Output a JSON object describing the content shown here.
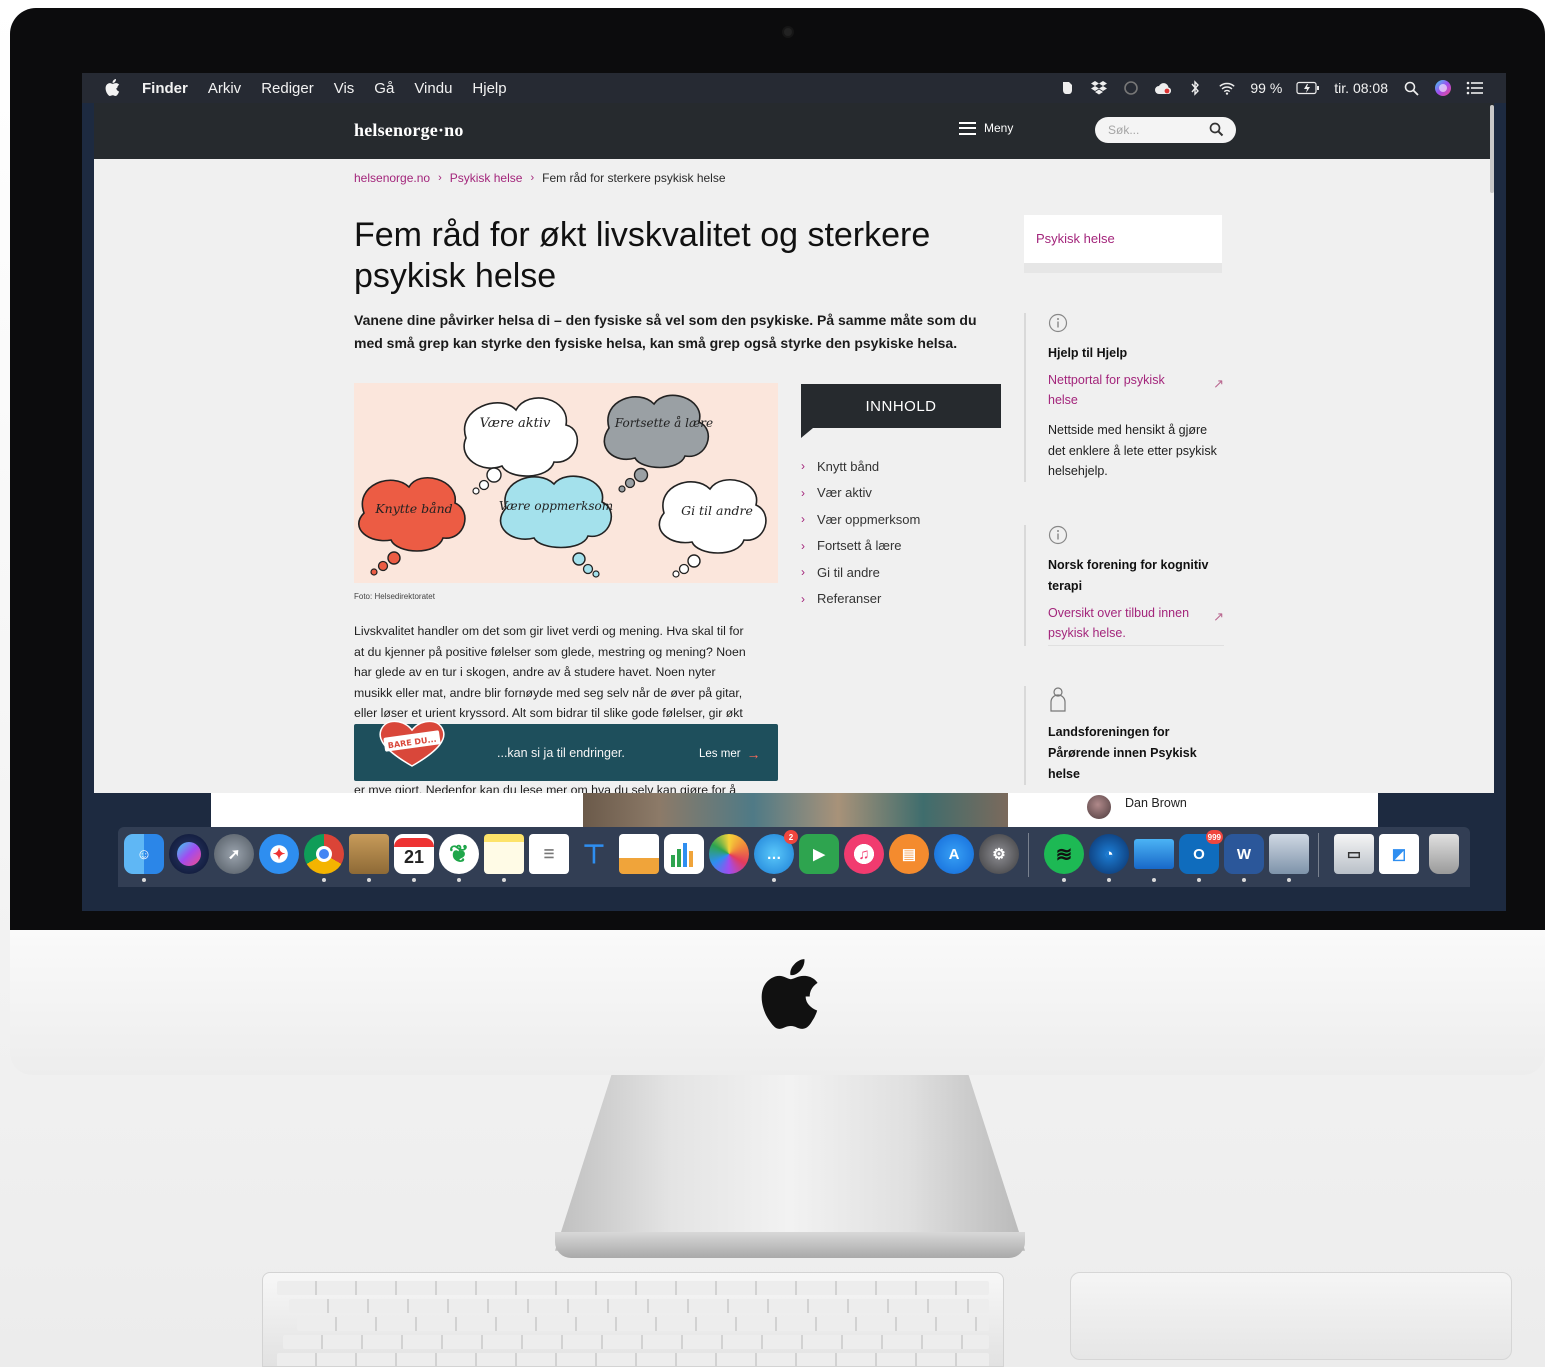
{
  "menubar": {
    "app_name": "Finder",
    "items": [
      "Arkiv",
      "Rediger",
      "Vis",
      "Gå",
      "Vindu",
      "Hjelp"
    ],
    "battery": "99 %",
    "clock": "tir. 08:08"
  },
  "site": {
    "logo": "helsenorge·no",
    "menu_label": "Meny",
    "search_placeholder": "Søk..."
  },
  "breadcrumb": [
    "helsenorge.no",
    "Psykisk helse",
    "Fem råd for sterkere psykisk helse"
  ],
  "article": {
    "title": "Fem råd for økt livskvalitet og sterkere psykisk helse",
    "ingress": "Vanene dine påvirker helsa di – den fysiske så vel som den psykiske. På samme måte som du med små grep kan styrke den fysiske helsa, kan små grep også styrke den psykiske helsa.",
    "photo_credit": "Foto: Helsedirektoratet",
    "clouds": [
      "Være aktiv",
      "Fortsette å lære",
      "Knytte bånd",
      "Være oppmerksom",
      "Gi til andre"
    ],
    "body_lines": [
      "Livskvalitet handler om det som gir livet verdi og mening. Hva skal til for",
      "at du kjenner på positive følelser som glede, mestring og mening? Noen",
      "har glede av en tur i skogen, andre av å studere havet. Noen nyter",
      "musikk eller mat, andre blir fornøyde med seg selv når de øver på gitar,",
      "eller løser et urient kryssord. Alt som bidrar til slike gode følelser, gir økt"
    ],
    "after_banner": "er mye gjort. Nedenfor kan du lese mer om hva du selv kan gjøre for å"
  },
  "toc": {
    "header": "INNHOLD",
    "items": [
      "Knytt bånd",
      "Vær aktiv",
      "Vær oppmerksom",
      "Fortsett å lære",
      "Gi til andre",
      "Referanser"
    ]
  },
  "banner": {
    "heart_text": "BARE DU...",
    "text": "...kan si ja til endringer.",
    "link": "Les mer"
  },
  "sidebar": {
    "tab": "Psykisk helse",
    "cards": [
      {
        "title": "Hjelp til Hjelp",
        "link": "Nettportal for psykisk helse",
        "desc": "Nettside med hensikt å gjøre det enklere å lete etter psykisk helsehjelp."
      },
      {
        "title": "Norsk forening for kognitiv terapi",
        "link": "Oversikt over tilbud innen psykisk helse."
      },
      {
        "title": "Landsforeningen for Pårørende innen Psykisk helse"
      }
    ]
  },
  "underlying": {
    "user_name": "Dan Brown"
  },
  "dock": {
    "calendar_day": "21",
    "badges": {
      "messages": "2",
      "outlook": "999"
    }
  },
  "colors": {
    "accent": "#a3257b",
    "header": "#262a2e",
    "banner": "#1e4f5c",
    "page_bg": "#f0f0f0"
  }
}
